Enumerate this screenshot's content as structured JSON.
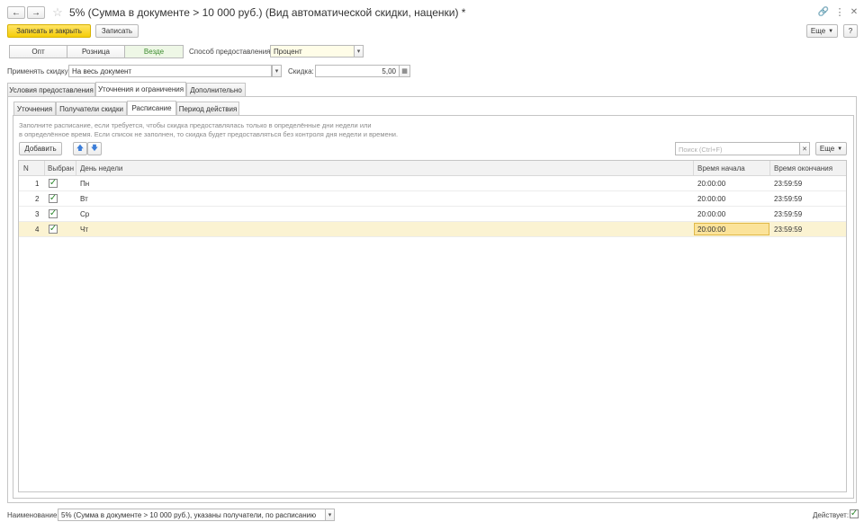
{
  "window": {
    "title": "5% (Сумма в документе > 10 000 руб.) (Вид автоматической скидки, наценки) *",
    "nav_back_icon": "arrow-left-icon",
    "nav_forward_icon": "arrow-right-icon",
    "favorite_icon": "star-icon",
    "link_icon": "link-icon",
    "menu_icon": "more-vertical-icon",
    "close_icon": "close-icon"
  },
  "toolbar": {
    "save_close_label": "Записать и закрыть",
    "save_label": "Записать",
    "more_label": "Еще",
    "help_label": "?"
  },
  "segments": {
    "items": [
      "Опт",
      "Розница",
      "Везде"
    ],
    "active": "Везде"
  },
  "method": {
    "label": "Способ предоставления:",
    "value": "Процент"
  },
  "apply": {
    "label": "Применять скидку:",
    "value": "На весь документ"
  },
  "discount": {
    "label": "Скидка:",
    "value": "5,00"
  },
  "main_tabs": [
    "Условия предоставления",
    "Уточнения и ограничения",
    "Дополнительно"
  ],
  "main_tab_active": "Уточнения и ограничения",
  "sub_tabs": [
    "Уточнения",
    "Получатели скидки",
    "Расписание",
    "Период действия"
  ],
  "sub_tab_active": "Расписание",
  "hint": {
    "line1": "Заполните расписание, если требуется, чтобы скидка предоставлялась только в определённые дни недели или",
    "line2": "в определённое время. Если список не заполнен, то скидка будет предоставляться без контроля дня недели и времени."
  },
  "grid_toolbar": {
    "add_label": "Добавить",
    "up_icon": "arrow-up-icon",
    "down_icon": "arrow-down-icon",
    "search_placeholder": "Поиск (Ctrl+F)",
    "search_clear_icon": "close-icon",
    "more_label": "Еще"
  },
  "table": {
    "columns": [
      "N",
      "Выбран",
      "День недели",
      "Время начала",
      "Время окончания"
    ],
    "rows": [
      {
        "n": "1",
        "selected": true,
        "day": "Пн",
        "start": "20:00:00",
        "end": "23:59:59"
      },
      {
        "n": "2",
        "selected": true,
        "day": "Вт",
        "start": "20:00:00",
        "end": "23:59:59"
      },
      {
        "n": "3",
        "selected": true,
        "day": "Ср",
        "start": "20:00:00",
        "end": "23:59:59"
      },
      {
        "n": "4",
        "selected": true,
        "day": "Чт",
        "start": "20:00:00",
        "end": "23:59:59"
      }
    ],
    "selected_row": 4
  },
  "footer": {
    "name_label": "Наименование:",
    "name_value": "5% (Сумма в документе > 10 000 руб.), указаны получатели, по расписанию",
    "active_label": "Действует:",
    "active_checked": true
  },
  "colors": {
    "primary_button": "#f5cd08",
    "selected_row": "#fbf3d2",
    "active_segment_text": "#3d8c2f",
    "check_mark": "#2f8a2f"
  }
}
